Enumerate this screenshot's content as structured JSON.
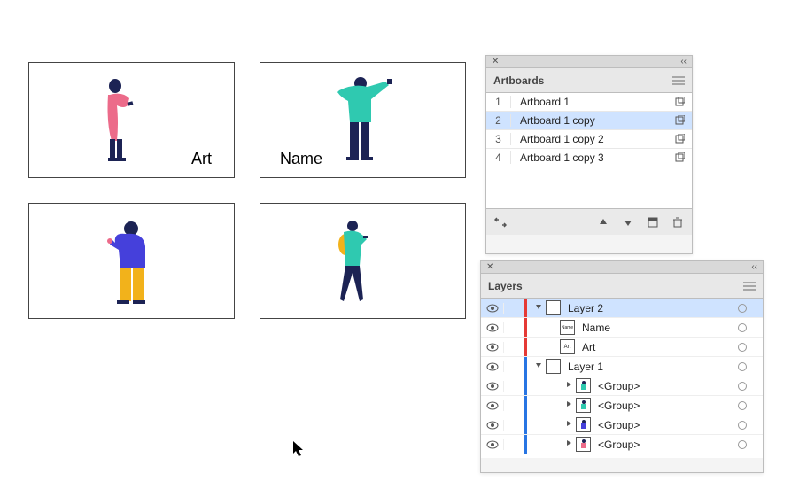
{
  "canvas": {
    "artboard1_label": "Art",
    "artboard2_label": "Name"
  },
  "panel_artboards": {
    "title": "Artboards",
    "rows": [
      {
        "index": "1",
        "name": "Artboard 1",
        "selected": false
      },
      {
        "index": "2",
        "name": "Artboard 1 copy",
        "selected": true
      },
      {
        "index": "3",
        "name": "Artboard 1 copy 2",
        "selected": false
      },
      {
        "index": "4",
        "name": "Artboard 1 copy 3",
        "selected": false
      }
    ]
  },
  "panel_layers": {
    "title": "Layers",
    "rows": [
      {
        "color": "red",
        "depth": 0,
        "twist": "down",
        "name": "Layer 2",
        "selected": true,
        "thumb": "blank"
      },
      {
        "color": "red",
        "depth": 1,
        "twist": "",
        "name": "Name",
        "selected": false,
        "thumb": "text-name"
      },
      {
        "color": "red",
        "depth": 1,
        "twist": "",
        "name": "Art",
        "selected": false,
        "thumb": "text-art"
      },
      {
        "color": "blue",
        "depth": 0,
        "twist": "down",
        "name": "Layer 1",
        "selected": false,
        "thumb": "blank"
      },
      {
        "color": "blue",
        "depth": 2,
        "twist": "right",
        "name": "<Group>",
        "selected": false,
        "thumb": "fig1"
      },
      {
        "color": "blue",
        "depth": 2,
        "twist": "right",
        "name": "<Group>",
        "selected": false,
        "thumb": "fig2"
      },
      {
        "color": "blue",
        "depth": 2,
        "twist": "right",
        "name": "<Group>",
        "selected": false,
        "thumb": "fig3"
      },
      {
        "color": "blue",
        "depth": 2,
        "twist": "right",
        "name": "<Group>",
        "selected": false,
        "thumb": "fig4"
      }
    ]
  }
}
